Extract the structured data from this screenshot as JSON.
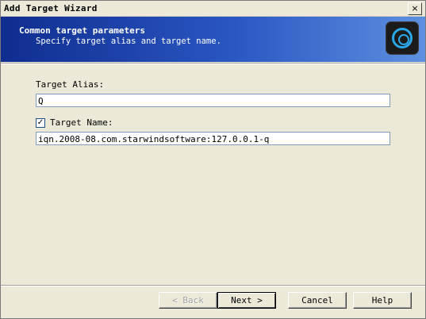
{
  "window": {
    "title": "Add Target Wizard",
    "close_glyph": "×"
  },
  "header": {
    "title": "Common target parameters",
    "subtitle": "Specify target alias and target name.",
    "logo_icon": "starwind-logo-icon"
  },
  "form": {
    "alias_label": "Target Alias:",
    "alias_value": "Q",
    "name_checkbox_checked": true,
    "name_label": "Target Name:",
    "name_value": "iqn.2008-08.com.starwindsoftware:127.0.0.1-q"
  },
  "buttons": {
    "back": "< Back",
    "next": "Next >",
    "cancel": "Cancel",
    "help": "Help"
  }
}
